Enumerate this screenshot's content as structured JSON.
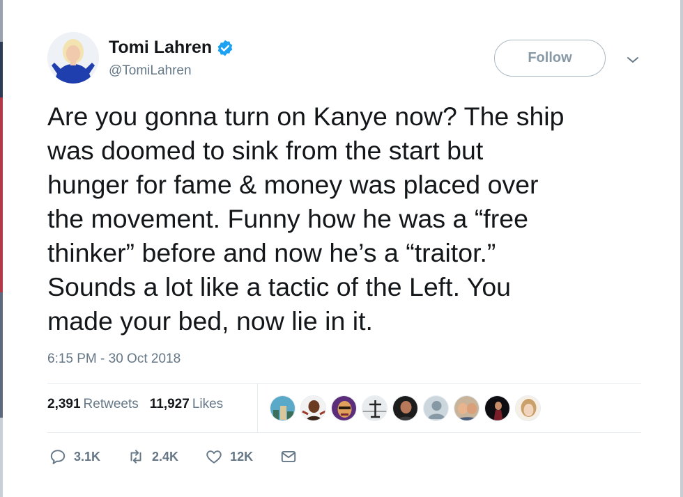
{
  "author": {
    "name": "Tomi Lahren",
    "handle": "@TomiLahren",
    "verified": true
  },
  "follow_label": "Follow",
  "tweet_lines": [
    "Are you gonna turn on Kanye now? The ship",
    "was doomed to sink from the start but",
    "hunger for fame & money was placed over",
    "the movement. Funny how he was a “free",
    "thinker” before and now he’s a “traitor.”",
    "Sounds a lot like a tactic of the Left. You",
    "made your bed, now lie in it."
  ],
  "timestamp": "6:15 PM - 30 Oct 2018",
  "stats": {
    "retweets_count": "2,391",
    "retweets_label": "Retweets",
    "likes_count": "11,927",
    "likes_label": "Likes"
  },
  "actions": {
    "replies": "3.1K",
    "retweets": "2.4K",
    "likes": "12K"
  },
  "icons": {
    "verified": "verified-badge-icon",
    "menu": "chevron-down-icon",
    "reply": "reply-icon",
    "retweet": "retweet-icon",
    "like": "heart-icon",
    "dm": "envelope-icon"
  },
  "colors": {
    "verified_blue": "#1da1f2",
    "secondary_text": "#657786",
    "primary_text": "#14171a",
    "border": "#e6ecf0"
  }
}
